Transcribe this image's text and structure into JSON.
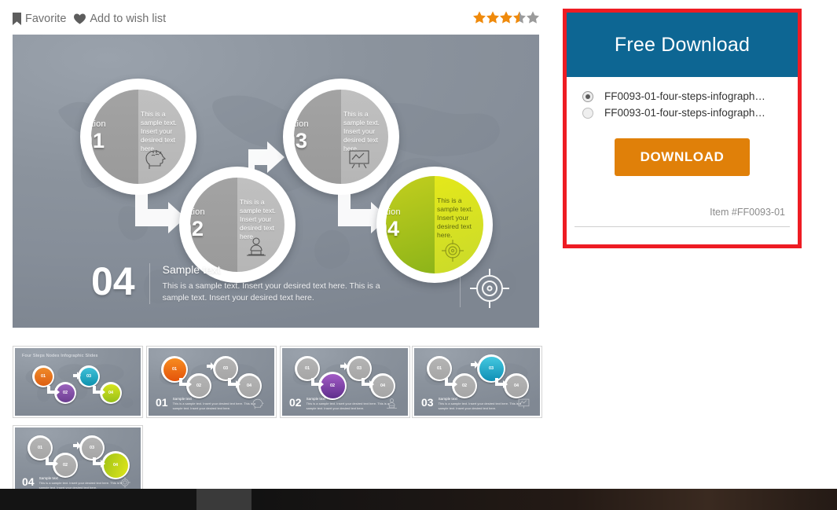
{
  "actions": {
    "favorite": {
      "label": "Favorite",
      "icon": "bookmark-icon"
    },
    "wishlist": {
      "label": "Add to wish list",
      "icon": "heart-icon"
    }
  },
  "rating": {
    "value": 3.5,
    "max": 5,
    "filled_color": "#ef8a0c",
    "empty_color": "#9b9b9b"
  },
  "hero": {
    "title_icon": "target-icon",
    "nodes": [
      {
        "option_label": "Option",
        "number": "01",
        "text": "This is a sample text. Insert your desired text here.",
        "icon": "head-idea-icon",
        "color": "#a3a3a3"
      },
      {
        "option_label": "Option",
        "number": "02",
        "text": "This is a sample text. Insert your desired text here.",
        "icon": "person-laptop-icon",
        "color": "#a3a3a3"
      },
      {
        "option_label": "Option",
        "number": "03",
        "text": "This is a sample text. Insert your desired text here.",
        "icon": "chart-board-icon",
        "color": "#a3a3a3"
      },
      {
        "option_label": "Option",
        "number": "04",
        "text": "This is a sample text. Insert your desired text here.",
        "icon": "target-icon",
        "color": "#c9da2b"
      }
    ],
    "caption": {
      "number": "04",
      "heading": "Sample text",
      "body": "This is a sample text. Insert your desired text here. This is a sample text. Insert your desired text here.",
      "icon": "target-icon"
    }
  },
  "thumbnails": [
    {
      "title": "Four Steps Nodes Infographic Slides",
      "active_step": null,
      "caption_number": "",
      "caption_heading": "",
      "caption_text": "",
      "colors": [
        "#e8661b",
        "#7c4aa0",
        "#1aa3b8",
        "#aecc2a"
      ],
      "selected": true
    },
    {
      "title": "",
      "active_step": 0,
      "caption_number": "01",
      "caption_heading": "Sample text",
      "caption_text": "This is a sample text. Insert your desired text here. This is a sample text. Insert your desired text here.",
      "colors": [
        "#ef7216",
        null,
        null,
        null
      ],
      "icon": "head-idea-icon",
      "selected": false
    },
    {
      "title": "",
      "active_step": 1,
      "caption_number": "02",
      "caption_heading": "Sample text",
      "caption_text": "This is a sample text. Insert your desired text here. This is a sample text. Insert your desired text here.",
      "colors": [
        null,
        "#8b4bb0",
        null,
        null
      ],
      "icon": "person-laptop-icon",
      "selected": false
    },
    {
      "title": "",
      "active_step": 2,
      "caption_number": "03",
      "caption_heading": "Sample text",
      "caption_text": "This is a sample text. Insert your desired text here. This is a sample text. Insert your desired text here.",
      "colors": [
        null,
        null,
        "#17a8cf",
        null
      ],
      "icon": "chart-board-icon",
      "selected": false
    },
    {
      "title": "",
      "active_step": 3,
      "caption_number": "04",
      "caption_heading": "Sample text",
      "caption_text": "This is a sample text. Insert your desired text here. This is a sample text. Insert your desired text here.",
      "colors": [
        null,
        null,
        null,
        "#c8d916"
      ],
      "icon": "target-icon",
      "selected": false
    }
  ],
  "download_panel": {
    "border_color": "#ee1c23",
    "header_color": "#0d6693",
    "title": "Free Download",
    "options": [
      {
        "label": "FF0093-01-four-steps-infograph…",
        "selected": true
      },
      {
        "label": "FF0093-01-four-steps-infograph…",
        "selected": false
      }
    ],
    "button": {
      "label": "DOWNLOAD",
      "color": "#e08009"
    },
    "item_number": "Item #FF0093-01"
  }
}
